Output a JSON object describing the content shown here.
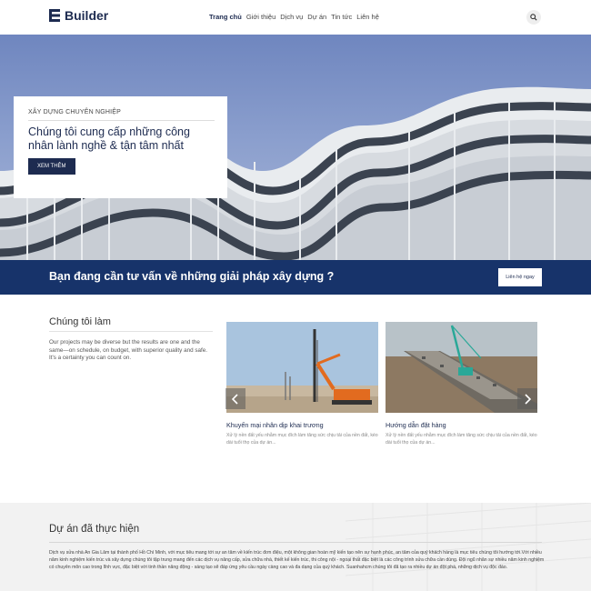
{
  "header": {
    "logo_text": "Builder",
    "nav": [
      "Trang chủ",
      "Giới thiệu",
      "Dịch vụ",
      "Dự án",
      "Tin tức",
      "Liên hệ"
    ],
    "search_icon": "search-icon"
  },
  "hero": {
    "kicker": "XÂY DỰNG CHUYÊN NGHIỆP",
    "title": "Chúng tôi cung cấp những công nhân lành nghề & tận tâm nhất",
    "button": "XEM THÊM"
  },
  "cta": {
    "text": "Bạn đang cần tư vấn về những giải pháp xây dựng ?",
    "button": "Liên hệ ngay"
  },
  "services": {
    "title": "Chúng tôi làm",
    "description": "Our projects may be diverse but the results are one and the same—on schedule, on budget, with superior quality and safe. It's a certainty you can count on.",
    "cards": [
      {
        "title": "Khuyến mại nhân dịp khai trương",
        "desc": "Xử lý nền đất yếu nhằm mục đích làm tăng sức chịu tải của nền đất, kéo dài tuổi thọ của dự án..."
      },
      {
        "title": "Hướng dẫn đặt hàng",
        "desc": "Xử lý nền đất yếu nhằm mục đích làm tăng sức chịu tải của nền đất, kéo dài tuổi thọ của dự án..."
      }
    ],
    "prev_icon": "chevron-left-icon",
    "next_icon": "chevron-right-icon"
  },
  "projects": {
    "title": "Dự án đã thực hiện",
    "description": "Dịch vụ sửa nhà An Gia Lâm tại thành phố Hồ Chí Minh, với mục tiêu mang tới sự an tâm về kiến trúc đơn điệu, một không gian hoàn mỹ kiến tạo nên sự hạnh phúc, an tâm của quý khách hàng là mục tiêu chúng tôi hướng tới.Với nhiều năm kinh nghiệm kiến trúc và xây dựng chúng tôi tập trung mang đến các dịch vụ nâng cấp, sửa chữa nhà, thiết kế kiến trúc, thi công nội - ngoại thất đặc biệt là các công trình sửa chữa cần dùng. Đội ngũ nhân sự nhiều năm kinh nghiệm có chuyên môn cao trong lĩnh vực, đặc biệt với tinh thần năng động - sáng tạo sẽ đáp ứng yêu cầu ngày càng cao và đa dạng của quý khách. Suanhahcm chúng tôi đã tạo ra nhiều dự án đột phá, những dịch vụ độc đáo."
  },
  "colors": {
    "brand_navy": "#1d2b50",
    "cta_blue": "#17336a"
  }
}
